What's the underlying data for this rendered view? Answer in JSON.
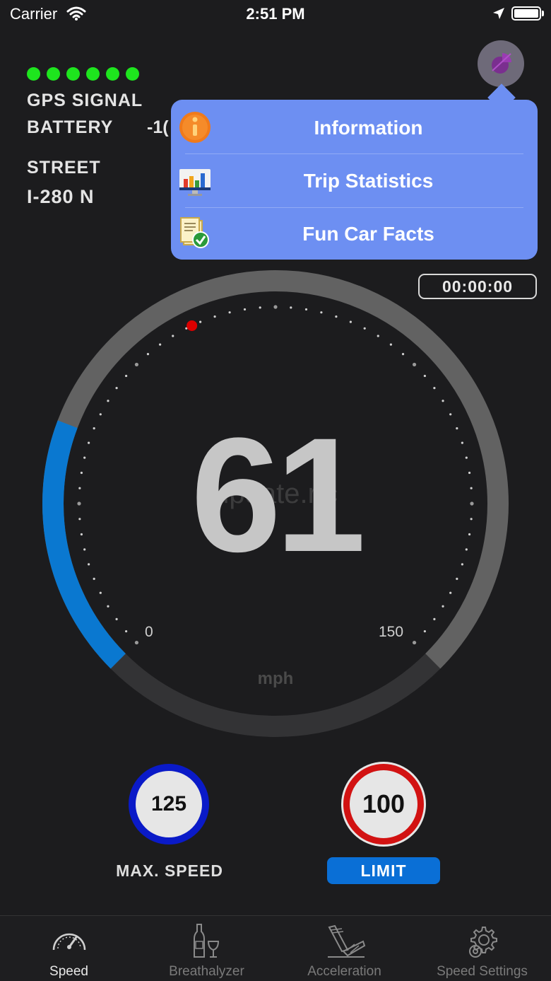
{
  "status_bar": {
    "carrier": "Carrier",
    "time": "2:51 PM"
  },
  "gps": {
    "signal_label": "GPS SIGNAL",
    "bars_lit": 6
  },
  "battery": {
    "label": "BATTERY",
    "value": "-1("
  },
  "street": {
    "label": "STREET",
    "value": "I-280 N"
  },
  "menu": {
    "items": [
      {
        "label": "Information",
        "icon": "info-icon"
      },
      {
        "label": "Trip Statistics",
        "icon": "chart-monitor-icon"
      },
      {
        "label": "Fun Car Facts",
        "icon": "document-check-icon"
      }
    ]
  },
  "timer": "00:00:00",
  "gauge": {
    "speed": "61",
    "min_label": "0",
    "max_label": "150",
    "unit": "mph",
    "watermark": "update.r.c",
    "speed_value": 61,
    "max_value": 150,
    "colors": {
      "progress": "#0a78d0",
      "track": "#626262",
      "marker": "#dd0000"
    }
  },
  "max_speed": {
    "value": "125",
    "label": "MAX. SPEED"
  },
  "limit": {
    "value": "100",
    "label": "LIMIT"
  },
  "tabs": [
    {
      "label": "Speed",
      "icon": "speedometer-icon",
      "active": true
    },
    {
      "label": "Breathalyzer",
      "icon": "bottle-glass-icon",
      "active": false
    },
    {
      "label": "Acceleration",
      "icon": "pedal-icon",
      "active": false
    },
    {
      "label": "Speed Settings",
      "icon": "gear-icon",
      "active": false
    }
  ]
}
